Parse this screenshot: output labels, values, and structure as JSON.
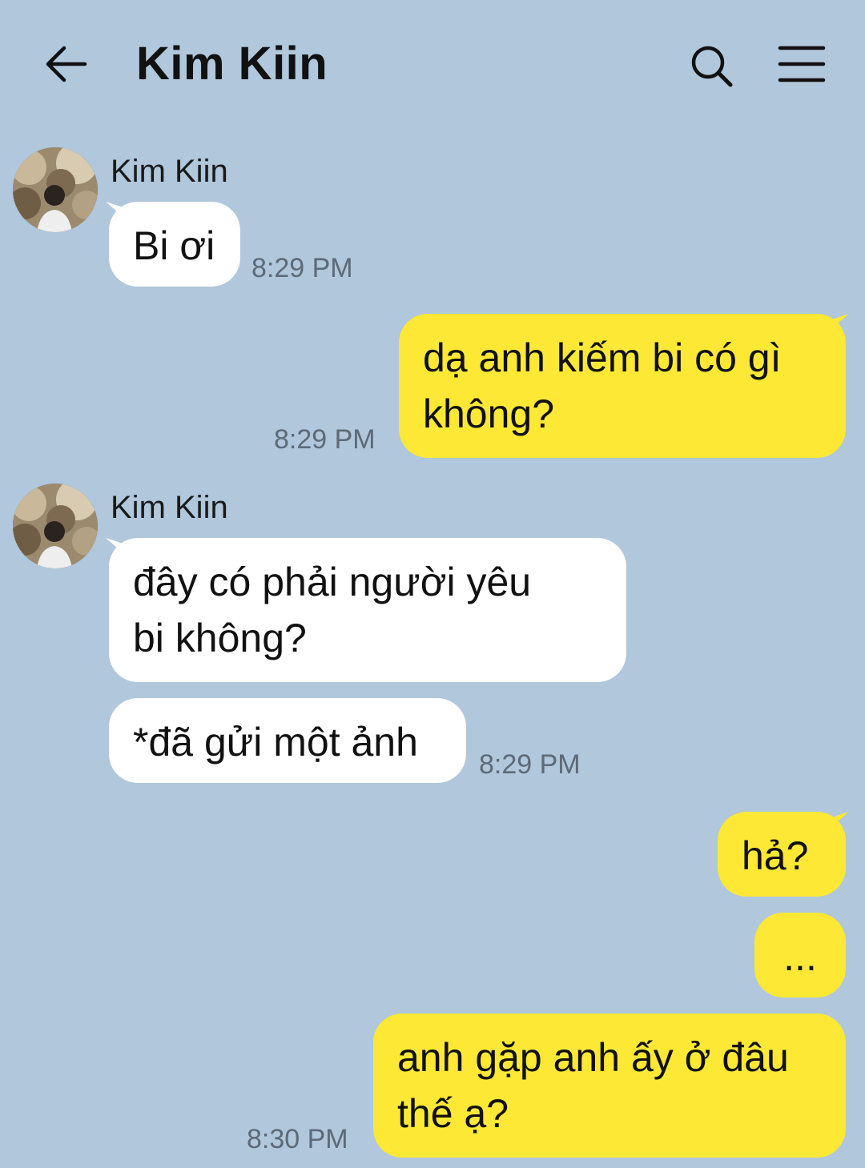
{
  "header": {
    "back_icon": "arrow-left-icon",
    "title": "Kim Kiin",
    "search_icon": "search-icon",
    "menu_icon": "hamburger-menu-icon"
  },
  "colors": {
    "background": "#b0c7dc",
    "incoming_bubble": "#ffffff",
    "outgoing_bubble": "#fce835",
    "timestamp": "#5d6a77"
  },
  "messages": [
    {
      "sender": "Kim Kiin",
      "direction": "incoming",
      "text": "Bi ơi",
      "time": "8:29 PM"
    },
    {
      "direction": "outgoing",
      "text": "dạ anh kiếm bi có gì không?",
      "time": "8:29 PM"
    },
    {
      "sender": "Kim Kiin",
      "direction": "incoming",
      "text": "đây có phải người yêu bi không?"
    },
    {
      "direction": "incoming",
      "text": "*đã gửi một ảnh",
      "time": "8:29 PM"
    },
    {
      "direction": "outgoing",
      "text": "hả?"
    },
    {
      "direction": "outgoing",
      "text": "..."
    },
    {
      "direction": "outgoing",
      "text": "anh gặp anh ấy ở đâu thế ạ?",
      "time": "8:30 PM"
    }
  ]
}
